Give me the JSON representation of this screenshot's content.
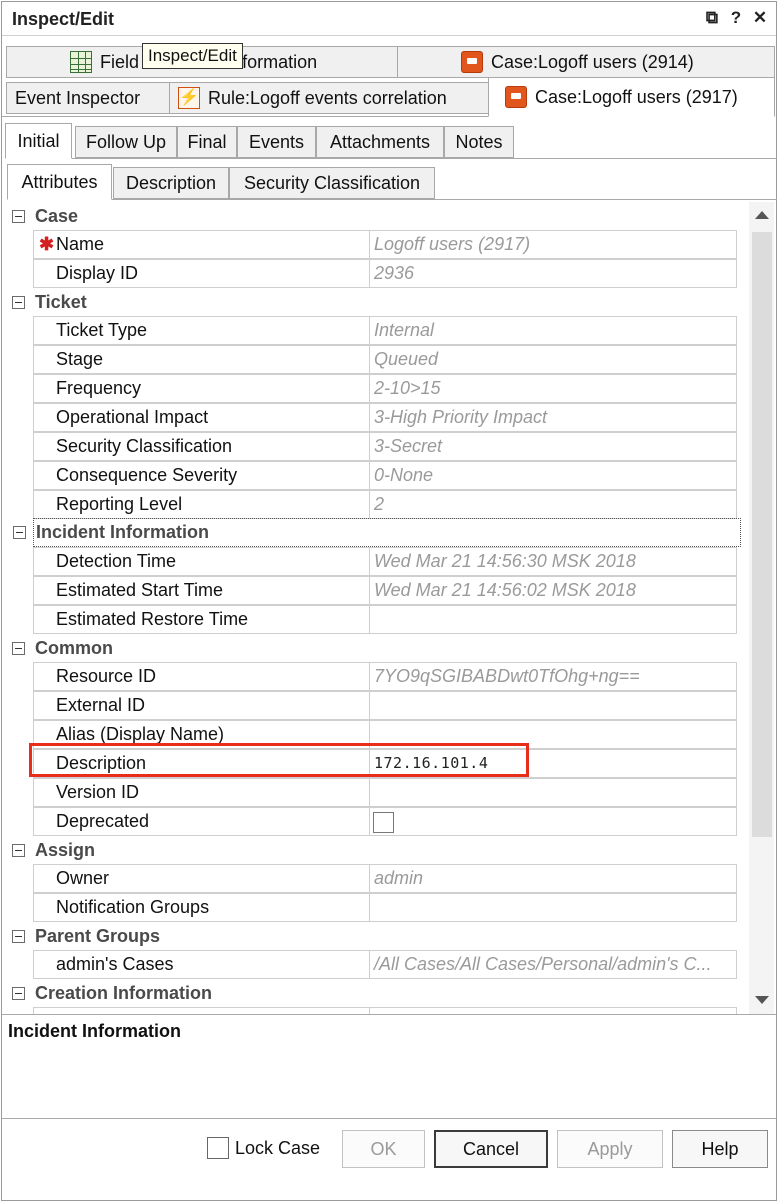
{
  "window": {
    "title": "Inspect/Edit"
  },
  "titlebar_icons": {
    "restore": "⧉",
    "help": "?",
    "close": "✕"
  },
  "tooltip": "Inspect/Edit",
  "editor_tabs_row1": [
    {
      "label": "Field Set: Base Information",
      "icon": "table-icon"
    },
    {
      "label": "Case:Logoff users (2914)",
      "icon": "case-icon"
    }
  ],
  "editor_tabs_row2": [
    {
      "label": "Event Inspector"
    },
    {
      "label": "Rule:Logoff events correlation",
      "icon": "rule-icon"
    },
    {
      "label": "Case:Logoff users (2917)",
      "icon": "case-icon",
      "active": true
    }
  ],
  "sub_tabs": [
    "Initial",
    "Follow Up",
    "Final",
    "Events",
    "Attachments",
    "Notes"
  ],
  "inner_tabs": [
    "Attributes",
    "Description",
    "Security Classification"
  ],
  "grid": {
    "categories": {
      "case": "Case",
      "ticket": "Ticket",
      "incident": "Incident Information",
      "common": "Common",
      "assign": "Assign",
      "parent_groups": "Parent Groups",
      "creation": "Creation Information"
    },
    "props": {
      "name": {
        "label": "Name",
        "value": "Logoff users (2917)"
      },
      "display_id": {
        "label": "Display ID",
        "value": "2936"
      },
      "ticket_type": {
        "label": "Ticket Type",
        "value": "Internal"
      },
      "stage": {
        "label": "Stage",
        "value": "Queued"
      },
      "frequency": {
        "label": "Frequency",
        "value": "2-10>15"
      },
      "operational_impact": {
        "label": "Operational Impact",
        "value": "3-High Priority Impact"
      },
      "security_classification": {
        "label": "Security Classification",
        "value": "3-Secret"
      },
      "consequence_severity": {
        "label": "Consequence Severity",
        "value": "0-None"
      },
      "reporting_level": {
        "label": "Reporting Level",
        "value": "2"
      },
      "detection_time": {
        "label": "Detection Time",
        "value": "Wed Mar 21 14:56:30 MSK 2018"
      },
      "estimated_start_time": {
        "label": "Estimated Start Time",
        "value": "Wed Mar 21 14:56:02 MSK 2018"
      },
      "estimated_restore_time": {
        "label": "Estimated Restore Time",
        "value": ""
      },
      "resource_id": {
        "label": "Resource ID",
        "value": "7YO9qSGIBABDwt0TfOhg+ng=="
      },
      "external_id": {
        "label": "External ID",
        "value": ""
      },
      "alias": {
        "label": "Alias (Display Name)",
        "value": ""
      },
      "description": {
        "label": "Description",
        "value": "172.16.101.4"
      },
      "version_id": {
        "label": "Version ID",
        "value": ""
      },
      "deprecated": {
        "label": "Deprecated",
        "checked": false
      },
      "owner": {
        "label": "Owner",
        "value": "admin"
      },
      "notification_groups": {
        "label": "Notification Groups",
        "value": ""
      },
      "admins_cases": {
        "label": "admin's Cases",
        "value": "/All Cases/All Cases/Personal/admin's C..."
      }
    }
  },
  "description_panel": {
    "title": "Incident Information"
  },
  "footer": {
    "lock_case": "Lock Case",
    "ok": "OK",
    "cancel": "Cancel",
    "apply": "Apply",
    "help": "Help"
  },
  "colors": {
    "highlight": "#e82e1a",
    "required": "#d42020"
  }
}
